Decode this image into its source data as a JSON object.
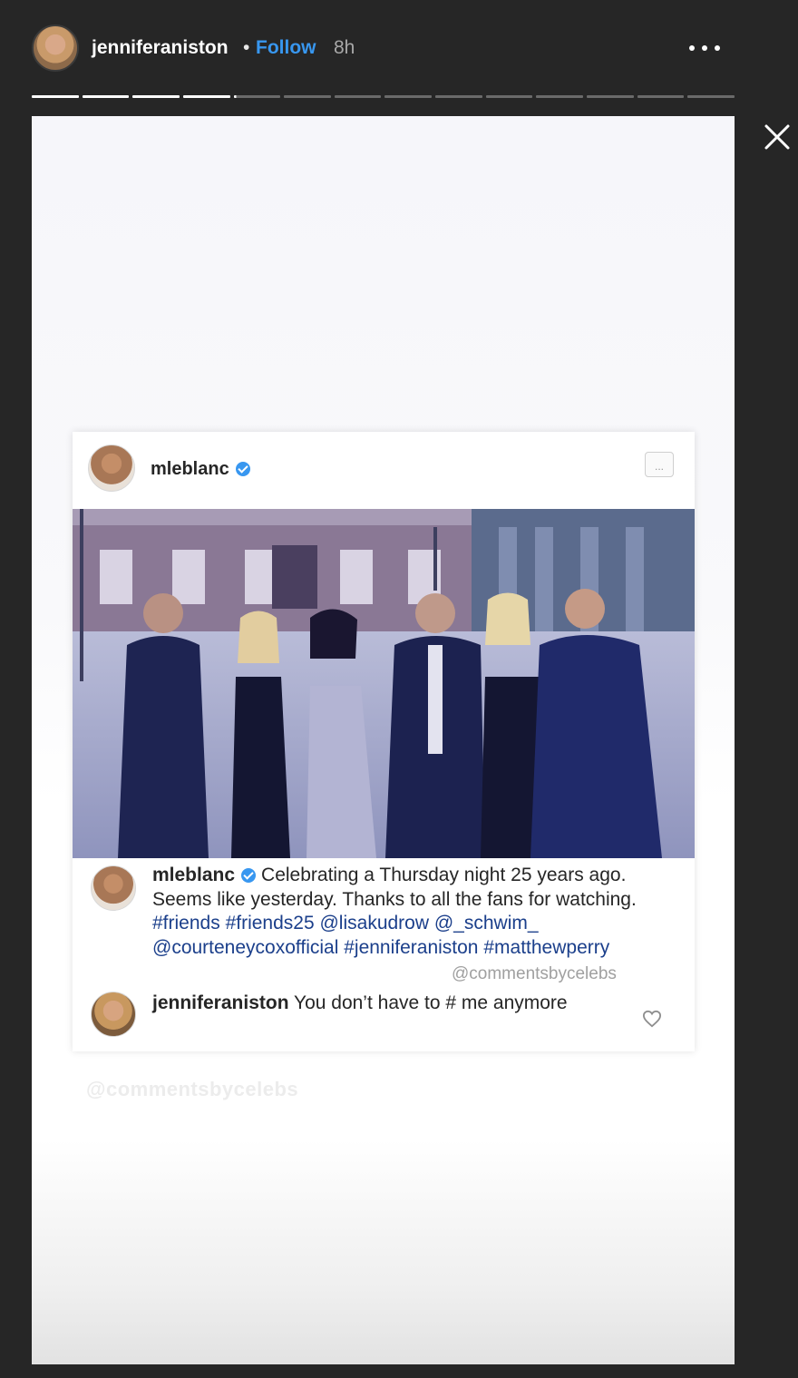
{
  "header": {
    "username": "jenniferaniston",
    "separator": "•",
    "follow_label": "Follow",
    "time": "8h",
    "more_icon": "more-horizontal-icon",
    "close_icon": "close-icon"
  },
  "progress": {
    "total_segments": 14,
    "completed_segments": 4,
    "current_fraction": 0.05
  },
  "story": {
    "post": {
      "username": "mleblanc",
      "verified": true,
      "photo_description_icon": "group-photo-image",
      "caption": {
        "username": "mleblanc",
        "text": "Celebrating a Thursday night 25 years ago. Seems like yesterday. Thanks to all the fans for watching.",
        "tags": [
          "#friends",
          "#friends25",
          "@lisakudrow",
          "@_schwim_",
          "@courteneycoxofficial",
          "#jenniferaniston",
          "#matthewperry"
        ]
      },
      "watermark": "@commentsbycelebs",
      "comment": {
        "username": "jenniferaniston",
        "text": "You don’t have to # me anymore"
      }
    },
    "bottom_watermark": "@commentsbycelebs"
  },
  "colors": {
    "background": "#262626",
    "follow": "#3897f0",
    "verified": "#3897f0"
  }
}
